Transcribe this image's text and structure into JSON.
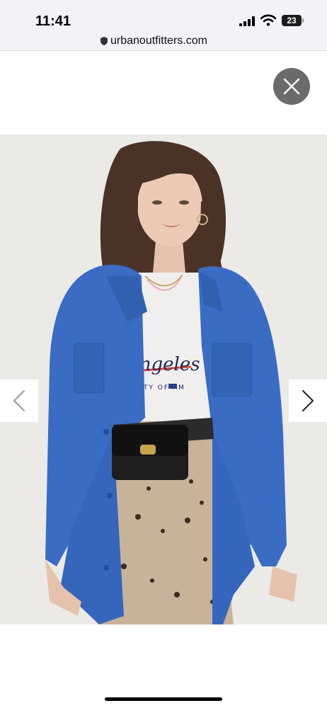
{
  "status_bar": {
    "time": "11:41",
    "battery_level": "23",
    "icons": [
      "cellular-signal-icon",
      "wifi-icon",
      "battery-icon"
    ]
  },
  "browser": {
    "url": "urbanoutfitters.com",
    "lock_icon": "lock-icon"
  },
  "viewer": {
    "close_icon": "close-icon",
    "prev_icon": "chevron-left-icon",
    "next_icon": "chevron-right-icon",
    "image_subject": "model wearing blue chore jacket",
    "tee_graphic_text": "Angeles",
    "tee_graphic_subtext": "CITY OF AM"
  },
  "colors": {
    "jacket_blue": "#3a6cc4",
    "close_button_bg": "#6b6b6b",
    "photo_bg": "#ebeae7"
  }
}
